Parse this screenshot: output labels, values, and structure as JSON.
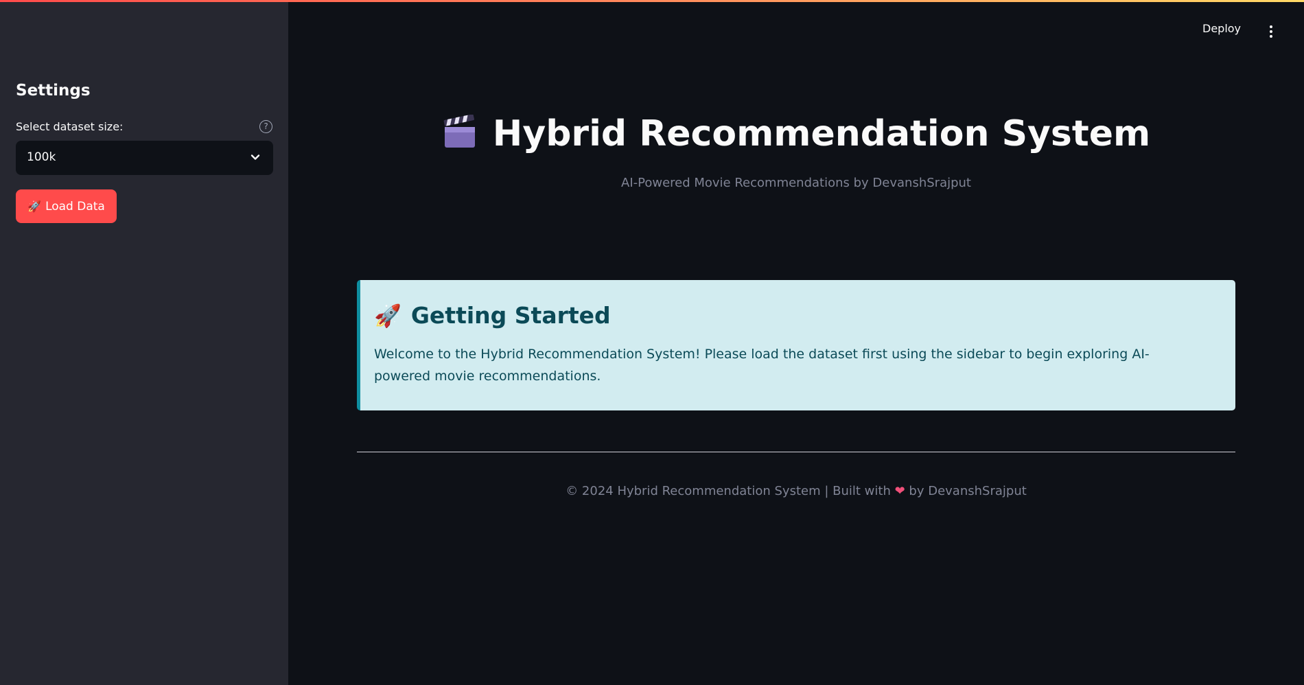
{
  "header": {
    "deploy_label": "Deploy",
    "menu_icon": "kebab-menu-icon"
  },
  "sidebar": {
    "title": "Settings",
    "dataset_select": {
      "label": "Select dataset size:",
      "value": "100k",
      "help_icon": "question-icon"
    },
    "load_button": {
      "icon": "rocket",
      "label": "Load Data"
    }
  },
  "main": {
    "title": "Hybrid Recommendation System",
    "title_icon": "clapperboard",
    "subtitle": "AI-Powered Movie Recommendations by DevanshSrajput",
    "info": {
      "icon": "rocket",
      "heading": "Getting Started",
      "text": "Welcome to the Hybrid Recommendation System! Please load the dataset first using the sidebar to begin exploring AI-powered movie recommendations."
    },
    "footer": {
      "prefix": "© 2024 Hybrid Recommendation System | Built with",
      "heart": "❤",
      "suffix": "by DevanshSrajput"
    }
  },
  "colors": {
    "primary": "#ff4b4b",
    "background": "#0e1117",
    "sidebar_bg": "#262730",
    "info_bg": "#d2ecf0",
    "info_text": "#0b4a57"
  }
}
